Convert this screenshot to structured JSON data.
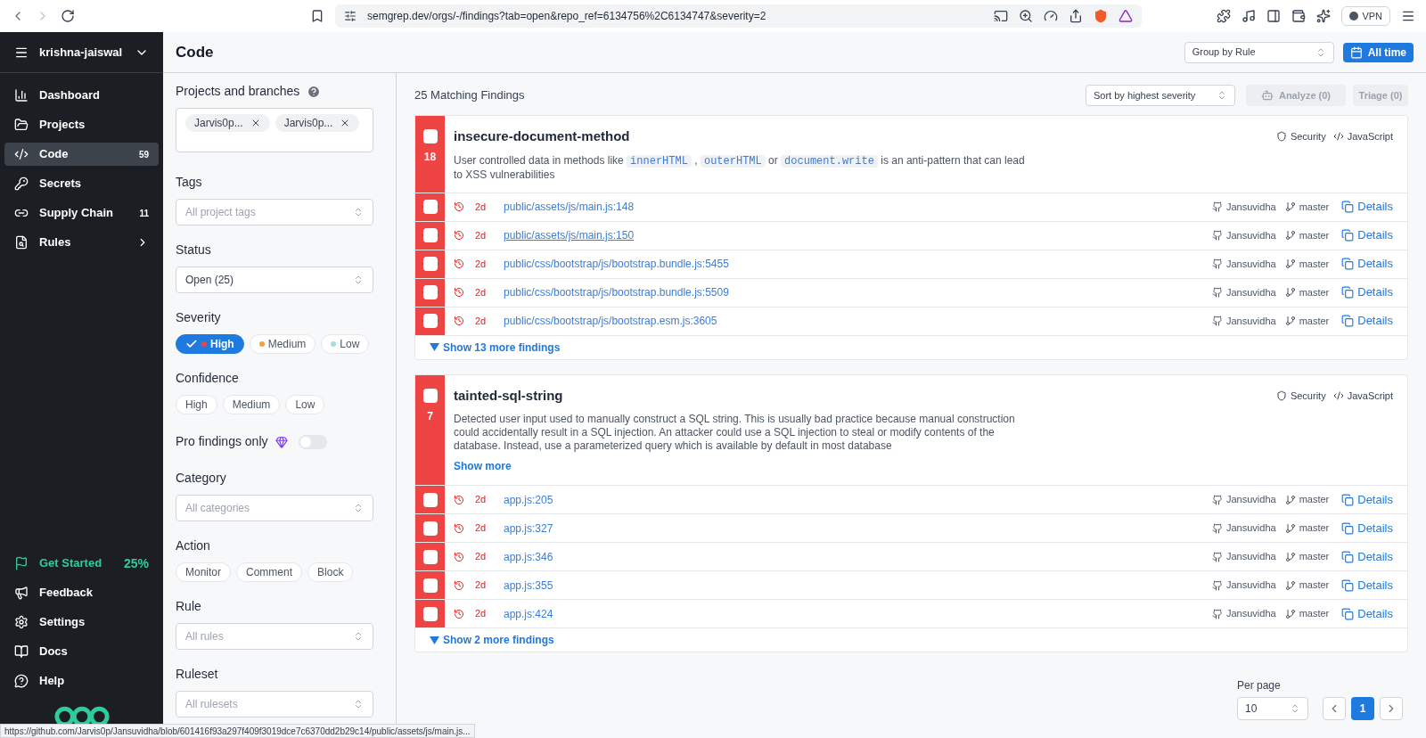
{
  "browser": {
    "url": "semgrep.dev/orgs/-/findings?tab=open&repo_ref=6134756%2C6134747&severity=2",
    "vpn": "VPN",
    "status_url": "https://github.com/Jarvis0p/Jansuvidha/blob/601416f93a297f409f3019dce7c6370dd2b29c14/public/assets/js/main.js..."
  },
  "sidebar": {
    "org": "krishna-jaiswal",
    "items": [
      {
        "kind": "dashboard",
        "label": "Dashboard",
        "selected": false
      },
      {
        "kind": "projects",
        "label": "Projects",
        "selected": false
      },
      {
        "kind": "code",
        "label": "Code",
        "badge": "59",
        "selected": true
      },
      {
        "kind": "secrets",
        "label": "Secrets",
        "selected": false
      },
      {
        "kind": "supply",
        "label": "Supply Chain",
        "badge": "11",
        "selected": false
      },
      {
        "kind": "rules",
        "label": "Rules",
        "selected": false,
        "chevron": true
      }
    ],
    "get_started": {
      "label": "Get Started",
      "value": "25%"
    },
    "bottom": [
      {
        "kind": "feedback",
        "label": "Feedback"
      },
      {
        "kind": "settings",
        "label": "Settings"
      },
      {
        "kind": "docs",
        "label": "Docs"
      },
      {
        "kind": "help",
        "label": "Help"
      }
    ]
  },
  "page": {
    "title": "Code",
    "group_by": "Group by Rule",
    "time": "All time"
  },
  "filters": {
    "projects": {
      "label": "Projects and branches",
      "chips": [
        "Jarvis0p...",
        "Jarvis0p..."
      ]
    },
    "tags": {
      "label": "Tags",
      "placeholder": "All project tags"
    },
    "status": {
      "label": "Status",
      "value": "Open (25)"
    },
    "severity": {
      "label": "Severity",
      "options": [
        {
          "label": "High",
          "color": "#ef4444",
          "selected": true
        },
        {
          "label": "Medium",
          "color": "#f0a04b",
          "selected": false
        },
        {
          "label": "Low",
          "color": "#a5dde0",
          "selected": false
        }
      ]
    },
    "confidence": {
      "label": "Confidence",
      "options": [
        {
          "label": "High",
          "selected": false
        },
        {
          "label": "Medium",
          "selected": false
        },
        {
          "label": "Low",
          "selected": false
        }
      ]
    },
    "pro": {
      "label": "Pro findings only",
      "on": false
    },
    "category": {
      "label": "Category",
      "placeholder": "All categories"
    },
    "action": {
      "label": "Action",
      "options": [
        {
          "label": "Monitor",
          "selected": false
        },
        {
          "label": "Comment",
          "selected": false
        },
        {
          "label": "Block",
          "selected": false
        }
      ]
    },
    "rule": {
      "label": "Rule",
      "placeholder": "All rules"
    },
    "ruleset": {
      "label": "Ruleset",
      "placeholder": "All rulesets"
    }
  },
  "findings": {
    "count": "25 Matching Findings",
    "sort": "Sort by highest severity",
    "analyze": "Analyze (0)",
    "triage": "Triage (0)",
    "groups": [
      {
        "title": "insecure-document-method",
        "count": "18",
        "checked": false,
        "category": "Security",
        "language": "JavaScript",
        "description": [
          {
            "kind": "text",
            "text": "User controlled data in methods like "
          },
          {
            "kind": "code",
            "text": "innerHTML"
          },
          {
            "kind": "text",
            "text": " , "
          },
          {
            "kind": "code",
            "text": "outerHTML"
          },
          {
            "kind": "text",
            "text": " or "
          },
          {
            "kind": "code",
            "text": "document.write"
          },
          {
            "kind": "text",
            "text": " is an anti-pattern that can lead to XSS vulnerabilities"
          }
        ],
        "rows": [
          {
            "age": "2d",
            "path": "public/assets/js/main.js:148",
            "repo": "Jansuvidha",
            "branch": "master",
            "details": "Details",
            "checked": false,
            "hovered": false
          },
          {
            "age": "2d",
            "path": "public/assets/js/main.js:150",
            "repo": "Jansuvidha",
            "branch": "master",
            "details": "Details",
            "checked": false,
            "hovered": true
          },
          {
            "age": "2d",
            "path": "public/css/bootstrap/js/bootstrap.bundle.js:5455",
            "repo": "Jansuvidha",
            "branch": "master",
            "details": "Details",
            "checked": false,
            "hovered": false
          },
          {
            "age": "2d",
            "path": "public/css/bootstrap/js/bootstrap.bundle.js:5509",
            "repo": "Jansuvidha",
            "branch": "master",
            "details": "Details",
            "checked": false,
            "hovered": false
          },
          {
            "age": "2d",
            "path": "public/css/bootstrap/js/bootstrap.esm.js:3605",
            "repo": "Jansuvidha",
            "branch": "master",
            "details": "Details",
            "checked": false,
            "hovered": false
          }
        ],
        "more": "Show 13 more findings"
      },
      {
        "title": "tainted-sql-string",
        "count": "7",
        "checked": false,
        "category": "Security",
        "language": "JavaScript",
        "description": [
          {
            "kind": "text",
            "text": "Detected user input used to manually construct a SQL string. This is usually bad practice because manual construction could accidentally result in a SQL injection. An attacker could use a SQL injection to steal or modify contents of the database. Instead, use a parameterized query which is available by default in most database"
          }
        ],
        "show_more": "Show more",
        "rows": [
          {
            "age": "2d",
            "path": "app.js:205",
            "repo": "Jansuvidha",
            "branch": "master",
            "details": "Details",
            "checked": false,
            "hovered": false
          },
          {
            "age": "2d",
            "path": "app.js:327",
            "repo": "Jansuvidha",
            "branch": "master",
            "details": "Details",
            "checked": false,
            "hovered": false
          },
          {
            "age": "2d",
            "path": "app.js:346",
            "repo": "Jansuvidha",
            "branch": "master",
            "details": "Details",
            "checked": false,
            "hovered": false
          },
          {
            "age": "2d",
            "path": "app.js:355",
            "repo": "Jansuvidha",
            "branch": "master",
            "details": "Details",
            "checked": false,
            "hovered": false
          },
          {
            "age": "2d",
            "path": "app.js:424",
            "repo": "Jansuvidha",
            "branch": "master",
            "details": "Details",
            "checked": false,
            "hovered": false
          }
        ],
        "more": "Show 2 more findings"
      }
    ]
  },
  "pagination": {
    "label": "Per page",
    "per_page": "10",
    "pages": [
      {
        "label": "1",
        "selected": true
      }
    ]
  }
}
